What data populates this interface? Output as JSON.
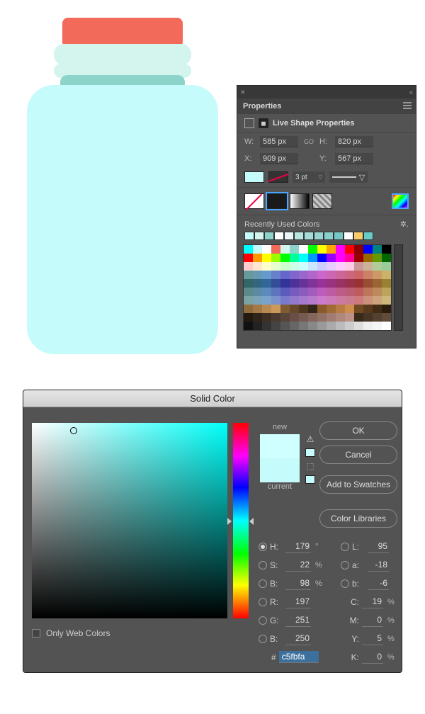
{
  "jar": {
    "cap": "#f26a59",
    "neck": "#d4f5ee",
    "neckshade": "#8cd3c9",
    "body": "#c5fbfa"
  },
  "properties": {
    "title": "Properties",
    "sub": "Live Shape Properties",
    "w_label": "W:",
    "w": "585 px",
    "link": "GO",
    "h_label": "H:",
    "h": "820 px",
    "x_label": "X:",
    "x": "909 px",
    "y_label": "Y:",
    "y": "567 px",
    "stroke_val": "3 pt",
    "recent_label": "Recently Used Colors",
    "recent": [
      "#c5fbfa",
      "#d4f5ee",
      "#8cd3c9",
      "#ffffff",
      "#e9f8f6",
      "#b8e6e3",
      "#a3dcd9",
      "#98d5d2",
      "#8acfcb",
      "#77c8c4",
      "#ffffff",
      "#facb6a",
      "#65ccc8"
    ],
    "palette": [
      "#00ffff",
      "#c5fbfa",
      "#ffffff",
      "#f26a59",
      "#d4f5ee",
      "#8cd3c9",
      "#ffffff",
      "#00ff00",
      "#ffff00",
      "#ffa500",
      "#ff00ff",
      "#ff0000",
      "#8b0000",
      "#0000ff",
      "#008080",
      "#000000",
      "#ff0000",
      "#ff9900",
      "#ffff00",
      "#99ff00",
      "#00ff00",
      "#00ff99",
      "#00ffff",
      "#0099ff",
      "#0000ff",
      "#9900ff",
      "#ff00ff",
      "#ff0099",
      "#990000",
      "#996600",
      "#669900",
      "#006600",
      "#ffcccc",
      "#ffe6cc",
      "#ffffcc",
      "#e6ffcc",
      "#ccffcc",
      "#ccffe6",
      "#ccffff",
      "#cce6ff",
      "#ccccff",
      "#e6ccff",
      "#ffccff",
      "#ffcce6",
      "#cc9999",
      "#ccb299",
      "#b2cc99",
      "#99cc99",
      "#669999",
      "#6699b2",
      "#6699cc",
      "#6680cc",
      "#6666cc",
      "#8066cc",
      "#9966cc",
      "#b266cc",
      "#cc66cc",
      "#cc66b2",
      "#cc6699",
      "#cc6680",
      "#cc6666",
      "#cc8066",
      "#cc9966",
      "#ccb266",
      "#336666",
      "#336680",
      "#336699",
      "#334d99",
      "#333399",
      "#4d3399",
      "#663399",
      "#803399",
      "#993399",
      "#993380",
      "#993366",
      "#99334d",
      "#993333",
      "#994d33",
      "#996633",
      "#998033",
      "#5c8a8a",
      "#5c8aa3",
      "#5c8abd",
      "#5c75bd",
      "#5c5cbd",
      "#755cbd",
      "#8a5cbd",
      "#a35cbd",
      "#bd5cbd",
      "#bd5ca3",
      "#bd5c8a",
      "#bd5c75",
      "#bd5c5c",
      "#bd755c",
      "#bd8a5c",
      "#bda35c",
      "#7aa3a3",
      "#7aa3b8",
      "#7aa3cc",
      "#7a91cc",
      "#7a7acc",
      "#917acc",
      "#a37acc",
      "#b87acc",
      "#cc7acc",
      "#cc7ab8",
      "#cc7aa3",
      "#cc7a91",
      "#cc7a7a",
      "#cc917a",
      "#cca37a",
      "#ccb87a",
      "#8f6b3d",
      "#a37a47",
      "#b88a52",
      "#cc995c",
      "#805c33",
      "#66492a",
      "#4d3720",
      "#332517",
      "#8a5a2b",
      "#a16b36",
      "#b87c42",
      "#cf8d4d",
      "#704a23",
      "#593b1c",
      "#422c15",
      "#2b1d0e",
      "#221a0e",
      "#30241a",
      "#3e2f25",
      "#4c3a30",
      "#5a453b",
      "#685046",
      "#765b51",
      "#84665c",
      "#927167",
      "#a07c72",
      "#ae877d",
      "#bc9288",
      "#382a1a",
      "#463524",
      "#54402e",
      "#624b38",
      "#111111",
      "#222222",
      "#333333",
      "#444444",
      "#555555",
      "#666666",
      "#777777",
      "#888888",
      "#999999",
      "#aaaaaa",
      "#bbbbbb",
      "#cccccc",
      "#dddddd",
      "#eeeeee",
      "#f5f5f5",
      "#ffffff"
    ]
  },
  "dialog": {
    "title": "Solid Color",
    "new_label": "new",
    "current_label": "current",
    "ok": "OK",
    "cancel": "Cancel",
    "add": "Add to Swatches",
    "libs": "Color Libraries",
    "only_web": "Only Web Colors",
    "H": "179",
    "Hu": "°",
    "S": "22",
    "Su": "%",
    "Bv": "98",
    "Bu": "%",
    "R": "197",
    "G": "251",
    "B": "250",
    "L": "95",
    "a": "-18",
    "b": "-6",
    "C": "19",
    "M": "0",
    "Y": "5",
    "K": "0",
    "Cu": "%",
    "hex_label": "#",
    "hex": "c5fbfa"
  }
}
